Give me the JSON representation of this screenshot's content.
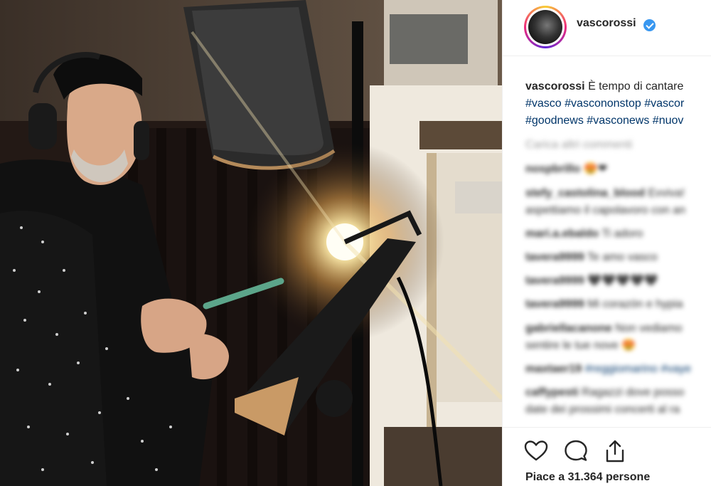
{
  "post": {
    "username": "vascorossi",
    "caption_text": "È tempo di cantare",
    "hashtags_line1": [
      "#vasco",
      "#vascononstop",
      "#vascor"
    ],
    "hashtags_line2": [
      "#goodnews",
      "#vasconews",
      "#nuov"
    ],
    "load_more": "Carica altri commenti",
    "likes": "Piace a 31.364 persone"
  },
  "comments": [
    {
      "user": "nospbrillo",
      "text": "😍❤"
    },
    {
      "user": "stefy_castolina_blood",
      "text": "Evviva!",
      "text2": "aspettiamo il capolavoro con an"
    },
    {
      "user": "mari.a.ebaldo",
      "text": "Ti adoro"
    },
    {
      "user": "tavera9999",
      "text": "Te amo vasco"
    },
    {
      "user": "tavera9999",
      "text": "🖤🖤🖤🖤🖤"
    },
    {
      "user": "tavera9999",
      "text": "Mi corazón e hypia"
    },
    {
      "user": "gabriellacanone",
      "text": "Non vediamo",
      "text2": "sentire le tue nove 😍"
    },
    {
      "user": "maxtaer19",
      "text": "#reggiomarino #vaye"
    },
    {
      "user": "caffypesti",
      "text": "Ragazzi dove posso",
      "text2": "date dei prossimi concerti al ra"
    }
  ],
  "colors": {
    "link": "#003569",
    "verified": "#3897f0",
    "text": "#262626"
  },
  "icons": [
    "heart-icon",
    "comment-icon",
    "share-icon"
  ]
}
